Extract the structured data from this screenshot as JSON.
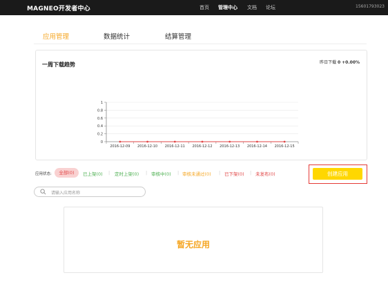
{
  "header": {
    "brand": "MAGNEO开发者中心",
    "nav": [
      "首页",
      "管理中心",
      "文档",
      "论坛"
    ],
    "phone": "15601793023"
  },
  "tabs": [
    "应用管理",
    "数据统计",
    "结算管理"
  ],
  "panel": {
    "title": "一周下载趋势",
    "yday_label": "昨日下载",
    "yday_value": "0",
    "yday_change": "+0.00%"
  },
  "chart_data": {
    "type": "line",
    "x": [
      "2016-12-09",
      "2016-12-10",
      "2016-12-11",
      "2016-12-12",
      "2016-12-13",
      "2016-12-14",
      "2016-12-15"
    ],
    "series": [
      {
        "values": [
          0,
          0,
          0,
          0,
          0,
          0,
          0
        ]
      }
    ],
    "yticks": [
      "0",
      "0.2",
      "0.4",
      "0.6",
      "0.8",
      "1"
    ],
    "ylim": [
      0,
      1
    ],
    "grid": true,
    "line_color": "#e04545"
  },
  "status": {
    "label": "应用状态:",
    "items": [
      {
        "text": "全部(0)",
        "color": "#e04545"
      },
      {
        "text": "已上架(0)",
        "color": "#4caf50"
      },
      {
        "text": "定时上架(0)",
        "color": "#4caf50"
      },
      {
        "text": "审核中(0)",
        "color": "#4caf50"
      },
      {
        "text": "审核未通过(0)",
        "color": "#f5a623"
      },
      {
        "text": "已下架(0)",
        "color": "#e04545"
      },
      {
        "text": "未发布(0)",
        "color": "#e04545"
      }
    ]
  },
  "create_button": "创建应用",
  "search": {
    "placeholder": "请输入应用名称"
  },
  "empty_text": "暂无应用"
}
